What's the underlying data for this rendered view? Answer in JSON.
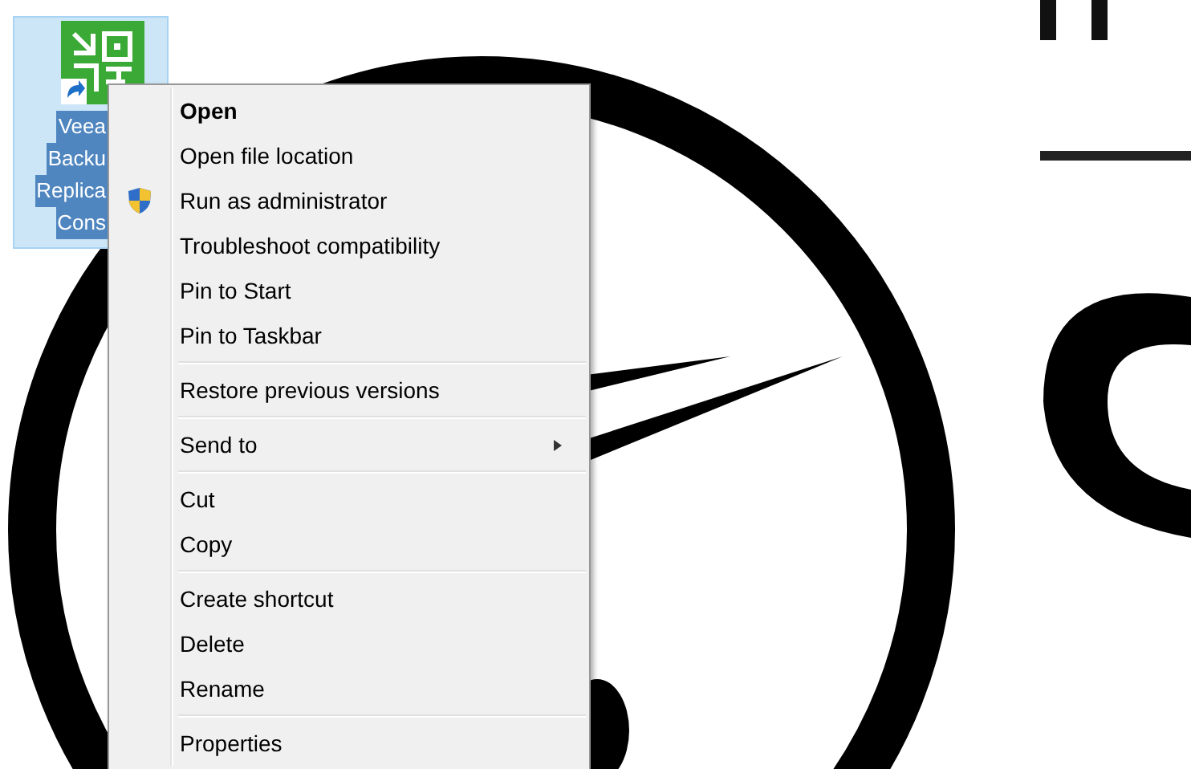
{
  "desktop_icon": {
    "label_lines": [
      "Veea",
      "Backu",
      "Replica",
      "Cons"
    ],
    "selected": true
  },
  "context_menu": {
    "items": [
      {
        "kind": "item",
        "label": "Open",
        "default": true,
        "shield": false,
        "submenu": false
      },
      {
        "kind": "item",
        "label": "Open file location",
        "default": false,
        "shield": false,
        "submenu": false
      },
      {
        "kind": "item",
        "label": "Run as administrator",
        "default": false,
        "shield": true,
        "submenu": false
      },
      {
        "kind": "item",
        "label": "Troubleshoot compatibility",
        "default": false,
        "shield": false,
        "submenu": false
      },
      {
        "kind": "item",
        "label": "Pin to Start",
        "default": false,
        "shield": false,
        "submenu": false
      },
      {
        "kind": "item",
        "label": "Pin to Taskbar",
        "default": false,
        "shield": false,
        "submenu": false
      },
      {
        "kind": "separator"
      },
      {
        "kind": "item",
        "label": "Restore previous versions",
        "default": false,
        "shield": false,
        "submenu": false
      },
      {
        "kind": "separator"
      },
      {
        "kind": "item",
        "label": "Send to",
        "default": false,
        "shield": false,
        "submenu": true
      },
      {
        "kind": "separator"
      },
      {
        "kind": "item",
        "label": "Cut",
        "default": false,
        "shield": false,
        "submenu": false
      },
      {
        "kind": "item",
        "label": "Copy",
        "default": false,
        "shield": false,
        "submenu": false
      },
      {
        "kind": "separator"
      },
      {
        "kind": "item",
        "label": "Create shortcut",
        "default": false,
        "shield": false,
        "submenu": false
      },
      {
        "kind": "item",
        "label": "Delete",
        "default": false,
        "shield": false,
        "submenu": false
      },
      {
        "kind": "item",
        "label": "Rename",
        "default": false,
        "shield": false,
        "submenu": false
      },
      {
        "kind": "separator"
      },
      {
        "kind": "item",
        "label": "Properties",
        "default": false,
        "shield": false,
        "submenu": false
      }
    ]
  }
}
